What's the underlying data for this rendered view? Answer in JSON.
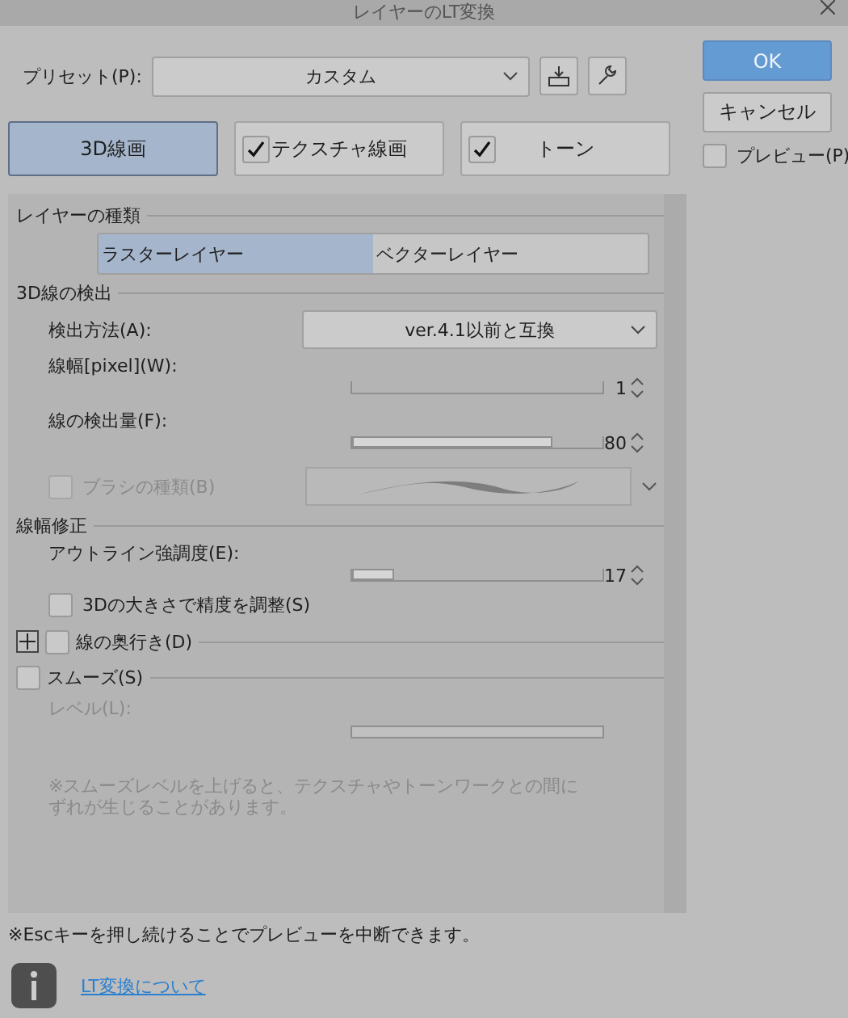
{
  "window": {
    "title": "レイヤーのLT変換"
  },
  "preset": {
    "label": "プリセット(P):",
    "value": "カスタム"
  },
  "buttons": {
    "ok": "OK",
    "cancel": "キャンセル"
  },
  "preview": {
    "label": "プレビュー(P)",
    "checked": false
  },
  "modes": [
    {
      "label": "3D線画",
      "kind": "plain",
      "selected": true
    },
    {
      "label": "テクスチャ線画",
      "kind": "checkbox",
      "checked": true,
      "selected": false
    },
    {
      "label": "トーン",
      "kind": "checkbox",
      "checked": true,
      "selected": false
    }
  ],
  "layer_type": {
    "title": "レイヤーの種類",
    "options": [
      {
        "label": "ラスターレイヤー",
        "selected": true
      },
      {
        "label": "ベクターレイヤー",
        "selected": false
      }
    ]
  },
  "detection": {
    "title": "3D線の検出",
    "method": {
      "label": "検出方法(A):",
      "value": "ver.4.1以前と互換"
    },
    "sliders": [
      {
        "label": "線幅[pixel](W):",
        "value": "1"
      },
      {
        "label": "線の検出量(F):",
        "value": "80",
        "level": 0.8
      }
    ],
    "brush": {
      "label": "ブラシの種類(B)",
      "checked": false,
      "disabled": true
    }
  },
  "correction": {
    "title": "線幅修正",
    "slider": {
      "label": "アウトライン強調度(E):",
      "value": "17",
      "level": 0.17
    },
    "scale": {
      "label": "3Dの大きさで精度を調整(S)",
      "checked": false
    }
  },
  "depth": {
    "label": "線の奥行き(D)",
    "checked": false,
    "expanded": false
  },
  "smooth": {
    "label": "スムーズ(S)",
    "checked": false,
    "level_label": "レベル(L):",
    "note": [
      "※スムーズレベルを上げると、テクスチャやトーンワークとの間に",
      "ずれが生じることがあります。"
    ]
  },
  "footer": {
    "note": "※Escキーを押し続けることでプレビューを中断できます。",
    "link": "LT変換について"
  }
}
